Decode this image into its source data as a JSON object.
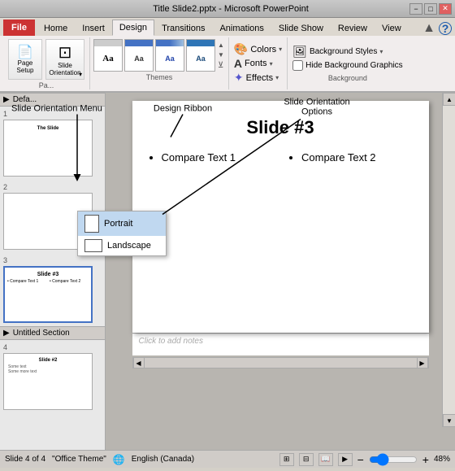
{
  "titlebar": {
    "title": "Title Slide2.pptx - Microsoft PowerPoint",
    "min": "−",
    "restore": "□",
    "close": "✕"
  },
  "tabs": {
    "file": "File",
    "items": [
      "Home",
      "Insert",
      "Design",
      "Transitions",
      "Animations",
      "Slide Show",
      "Review",
      "View"
    ],
    "active": "Design"
  },
  "ribbon": {
    "page_setup_label": "Pa...",
    "page_setup_btn": "Page\nSetup",
    "slide_orientation_label": "Slide\nOrientation",
    "themes_label": "Themes",
    "colors_label": "Colors",
    "colors_arrow": "▾",
    "fonts_label": "Fonts",
    "fonts_arrow": "▾",
    "effects_label": "Effects",
    "effects_arrow": "▾",
    "background_styles_label": "Background Styles",
    "background_styles_arrow": "▾",
    "hide_background_label": "Hide Background Graphics",
    "background_group_label": "Background",
    "aa_label": "Aa"
  },
  "orientation_menu": {
    "portrait_label": "Portrait",
    "landscape_label": "Landscape"
  },
  "annotations": {
    "slide_orientation_menu": "Slide Orientation Menu",
    "design_ribbon": "Design Ribbon",
    "slide_orientation_options": "Slide Orientation\nOptions"
  },
  "slide3": {
    "title": "Slide #3",
    "col1_bullet": "Compare Text 1",
    "col2_bullet": "Compare Text 2"
  },
  "notes": {
    "placeholder": "Click to add notes"
  },
  "slides": [
    {
      "number": "1",
      "title": "The Slide",
      "content": ""
    },
    {
      "number": "2",
      "title": "",
      "content": ""
    },
    {
      "number": "3",
      "title": "Slide #3",
      "content": "Compare Text 1\nCompare Text 2"
    },
    {
      "number": "4",
      "title": "Slide #2",
      "content": "Some text\nSome more text"
    }
  ],
  "sections": {
    "default": "▶ Defa...",
    "untitled": "▶ Untitled Section"
  },
  "statusbar": {
    "slide_count": "Slide 4 of 4",
    "theme": "\"Office Theme\"",
    "language": "English (Canada)",
    "zoom": "48%",
    "zoom_minus": "−",
    "zoom_plus": "+"
  }
}
